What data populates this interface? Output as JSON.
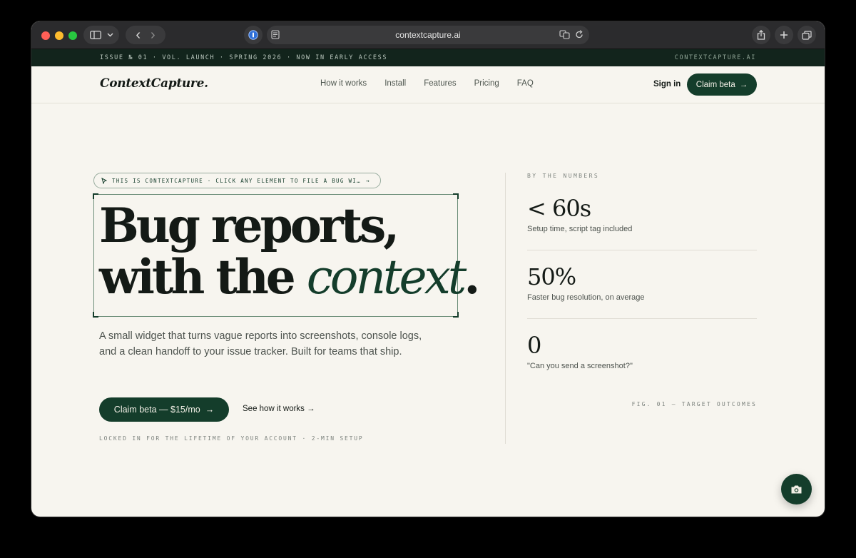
{
  "browser": {
    "url": "contextcapture.ai",
    "back_glyph": "‹",
    "forward_glyph": "›"
  },
  "ticker": {
    "left": "ISSUE № 01 · VOL. LAUNCH · SPRING 2026 · NOW IN EARLY ACCESS",
    "right": "CONTEXTCAPTURE.AI"
  },
  "nav": {
    "logo": "ContextCapture.",
    "links": [
      "How it works",
      "Install",
      "Features",
      "Pricing",
      "FAQ"
    ],
    "signin": "Sign in",
    "claim": "Claim beta",
    "claim_arrow": "→"
  },
  "hero": {
    "tag": "THIS IS CONTEXTCAPTURE · CLICK ANY ELEMENT TO FILE A BUG WI…",
    "tag_arrow": "→",
    "headline_line1": "Bug reports,",
    "headline_line2_plain": "with the ",
    "headline_line2_accent": "context",
    "headline_line2_period": ".",
    "lede": "A small widget that turns vague reports into screenshots, console logs, and a clean handoff to your issue tracker. Built for teams that ship.",
    "cta": "Claim beta — $15/mo",
    "cta_arrow": "→",
    "secondary": "See how it works →",
    "fine": "LOCKED IN FOR THE LIFETIME OF YOUR ACCOUNT · 2-MIN SETUP"
  },
  "stats": {
    "label": "BY THE NUMBERS",
    "items": [
      {
        "value": "< 60s",
        "desc": "Setup time, script tag included"
      },
      {
        "value": "50%",
        "desc": "Faster bug resolution, on average"
      },
      {
        "value": "0",
        "desc": "\"Can you send a screenshot?\""
      }
    ],
    "fig": "FIG. 01 — TARGET OUTCOMES"
  },
  "colors": {
    "accent": "#143d2b",
    "background": "#f7f5ef",
    "ticker_bg": "#12241c"
  }
}
